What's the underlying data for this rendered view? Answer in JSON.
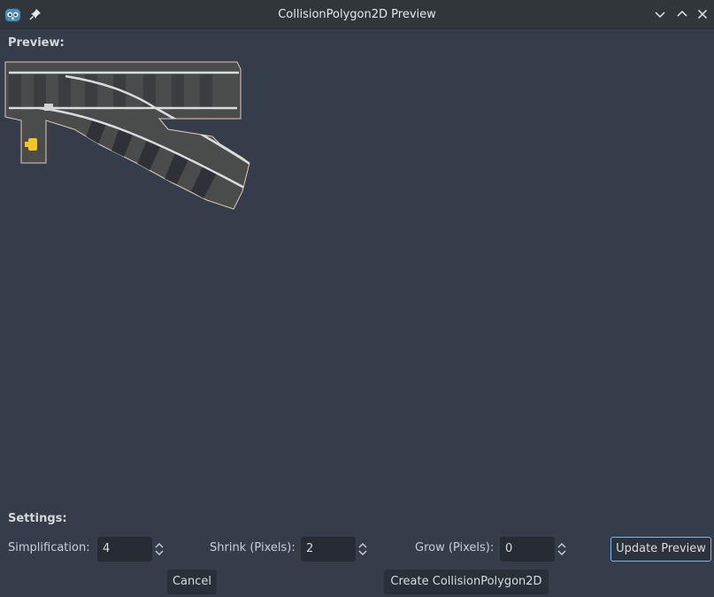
{
  "window": {
    "title": "CollisionPolygon2D Preview"
  },
  "icons": {
    "app": "godot-logo-icon",
    "pin": "pin-icon",
    "minimize": "chevron-down-icon",
    "maximize": "chevron-up-icon",
    "close": "close-icon"
  },
  "preview": {
    "heading": "Preview:"
  },
  "settings": {
    "heading": "Settings:",
    "simplification_label": "Simplification:",
    "simplification_value": "4",
    "shrink_label": "Shrink (Pixels):",
    "shrink_value": "2",
    "grow_label": "Grow (Pixels):",
    "grow_value": "0",
    "update_button": "Update Preview"
  },
  "footer": {
    "cancel_button": "Cancel",
    "create_button": "Create CollisionPolygon2D"
  },
  "colors": {
    "background": "#363d4a",
    "titlebar": "#31363b",
    "field": "#262b34",
    "focus_border": "#7fb8f0"
  }
}
